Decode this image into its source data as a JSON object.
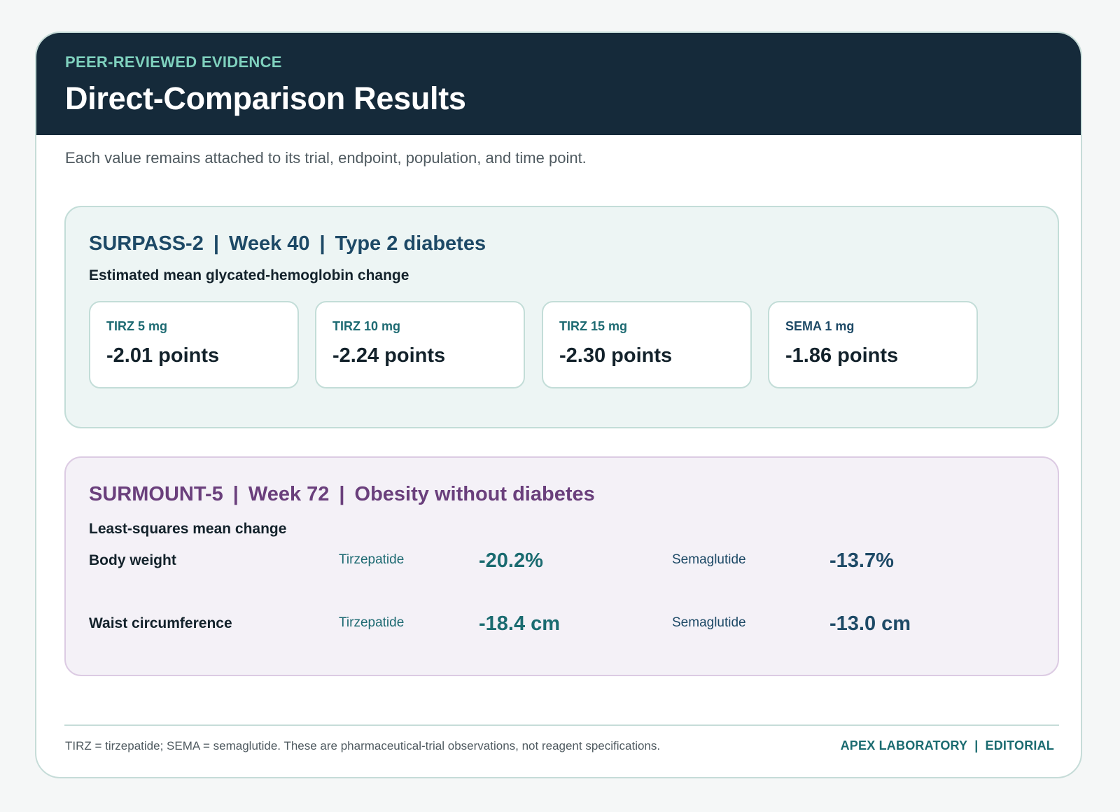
{
  "header": {
    "eyebrow": "PEER-REVIEWED EVIDENCE",
    "title": "Direct-Comparison Results"
  },
  "subtitle": "Each value remains attached to its trial, endpoint, population, and time point.",
  "surpass": {
    "trial": "SURPASS-2",
    "timepoint": "Week 40",
    "population": "Type 2 diabetes",
    "endpoint": "Estimated mean glycated-hemoglobin change",
    "arms": [
      {
        "label": "TIRZ 5 mg",
        "value": "-2.01 points"
      },
      {
        "label": "TIRZ 10 mg",
        "value": "-2.24 points"
      },
      {
        "label": "TIRZ 15 mg",
        "value": "-2.30 points"
      },
      {
        "label": "SEMA 1 mg",
        "value": "-1.86 points"
      }
    ]
  },
  "surmount": {
    "trial": "SURMOUNT-5",
    "timepoint": "Week 72",
    "population": "Obesity without diabetes",
    "endpoint": "Least-squares mean change",
    "rows": [
      {
        "label": "Body weight",
        "drug_a": "Tirzepatide",
        "value_a": "-20.2%",
        "drug_b": "Semaglutide",
        "value_b": "-13.7%"
      },
      {
        "label": "Waist circumference",
        "drug_a": "Tirzepatide",
        "value_a": "-18.4 cm",
        "drug_b": "Semaglutide",
        "value_b": "-13.0 cm"
      }
    ]
  },
  "footer": {
    "note": "TIRZ = tirzepatide; SEMA = semaglutide. These are pharmaceutical-trial observations, not reagent specifications.",
    "brand_left": "APEX LABORATORY",
    "brand_right": "EDITORIAL"
  },
  "colors": {
    "header_bg": "#152a3a",
    "accent_teal": "#7fd1be",
    "surpass_title": "#1d4966",
    "surmount_title": "#6a3f7c"
  }
}
